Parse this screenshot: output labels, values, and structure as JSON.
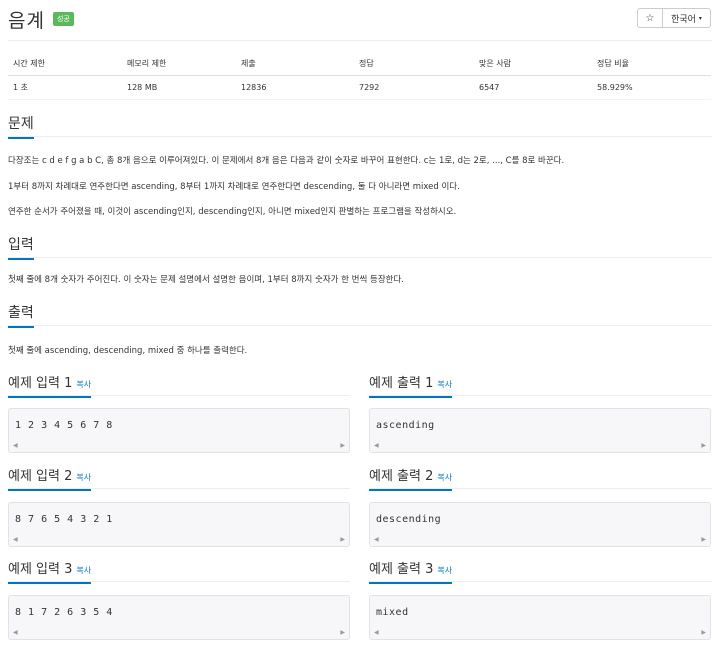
{
  "header": {
    "title": "음계",
    "status_badge": "성공",
    "star_glyph": "☆",
    "language_label": "한국어",
    "caret_glyph": "▾"
  },
  "info": {
    "headers": [
      "시간 제한",
      "메모리 제한",
      "제출",
      "정답",
      "맞은 사람",
      "정답 비율"
    ],
    "values": [
      "1 초",
      "128 MB",
      "12836",
      "7292",
      "6547",
      "58.929%"
    ]
  },
  "problem": {
    "heading": "문제",
    "lines": [
      "다장조는 c d e f g a b C, 총 8개 음으로 이루어져있다. 이 문제에서 8개 음은 다음과 같이 숫자로 바꾸어 표현한다. c는 1로, d는 2로, ..., C를 8로 바꾼다.",
      "1부터 8까지 차례대로 연주한다면 ascending, 8부터 1까지 차례대로 연주한다면 descending, 둘 다 아니라면 mixed 이다.",
      "연주한 순서가 주어졌을 때, 이것이 ascending인지, descending인지, 아니면 mixed인지 판별하는 프로그램을 작성하시오."
    ]
  },
  "input": {
    "heading": "입력",
    "text": "첫째 줄에 8개 숫자가 주어진다. 이 숫자는 문제 설명에서 설명한 음이며, 1부터 8까지 숫자가 한 번씩 등장한다."
  },
  "output": {
    "heading": "출력",
    "text": "첫째 줄에 ascending, descending, mixed 중 하나를 출력한다."
  },
  "samples": {
    "copy_label": "복사",
    "scroll_left": "◀",
    "scroll_right": "▶",
    "items": [
      {
        "input_title": "예제 입력 1",
        "input": "1 2 3 4 5 6 7 8",
        "output_title": "예제 출력 1",
        "output": "ascending"
      },
      {
        "input_title": "예제 입력 2",
        "input": "8 7 6 5 4 3 2 1",
        "output_title": "예제 출력 2",
        "output": "descending"
      },
      {
        "input_title": "예제 입력 3",
        "input": "8 1 7 2 6 3 5 4",
        "output_title": "예제 출력 3",
        "output": "mixed"
      }
    ]
  },
  "colors": {
    "accent": "#0076c0",
    "success": "#5cb85c"
  }
}
